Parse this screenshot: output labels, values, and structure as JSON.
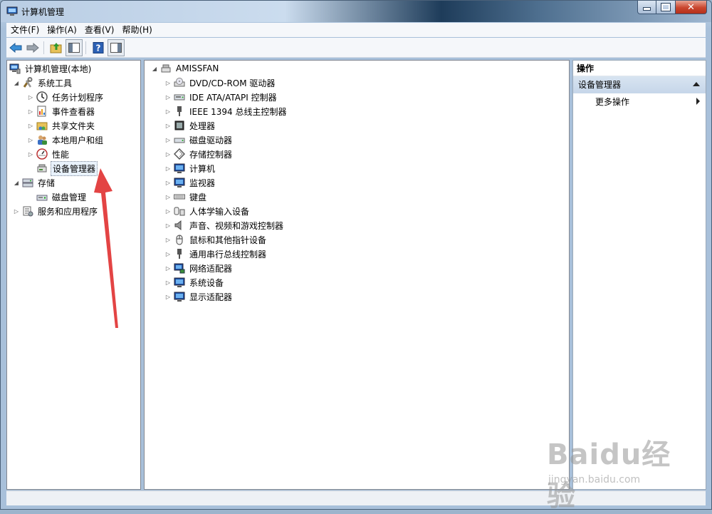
{
  "window": {
    "title": "计算机管理"
  },
  "menu": [
    "文件(F)",
    "操作(A)",
    "查看(V)",
    "帮助(H)"
  ],
  "toolbar": {
    "buttons": [
      "back-icon",
      "forward-icon",
      "up-folder-icon",
      "show-hide-tree-icon",
      "help-icon",
      "show-hide-action-pane-icon"
    ]
  },
  "left_tree": {
    "root": "计算机管理(本地)",
    "system_tools": "系统工具",
    "system_tools_children": [
      "任务计划程序",
      "事件查看器",
      "共享文件夹",
      "本地用户和组",
      "性能",
      "设备管理器"
    ],
    "storage": "存储",
    "storage_children": [
      "磁盘管理"
    ],
    "services": "服务和应用程序"
  },
  "center_tree": {
    "root": "AMISSFAN",
    "items": [
      "DVD/CD-ROM 驱动器",
      "IDE ATA/ATAPI 控制器",
      "IEEE 1394 总线主控制器",
      "处理器",
      "磁盘驱动器",
      "存储控制器",
      "计算机",
      "监视器",
      "键盘",
      "人体学输入设备",
      "声音、视频和游戏控制器",
      "鼠标和其他指针设备",
      "通用串行总线控制器",
      "网络适配器",
      "系统设备",
      "显示适配器"
    ]
  },
  "actions": {
    "title": "操作",
    "group": "设备管理器",
    "more": "更多操作"
  },
  "watermark": {
    "logo": "Baidu经验",
    "url": "jingyan.baidu.com"
  },
  "colors": {
    "annotation_arrow": "#e03030",
    "selection": "#e9f2fc"
  }
}
